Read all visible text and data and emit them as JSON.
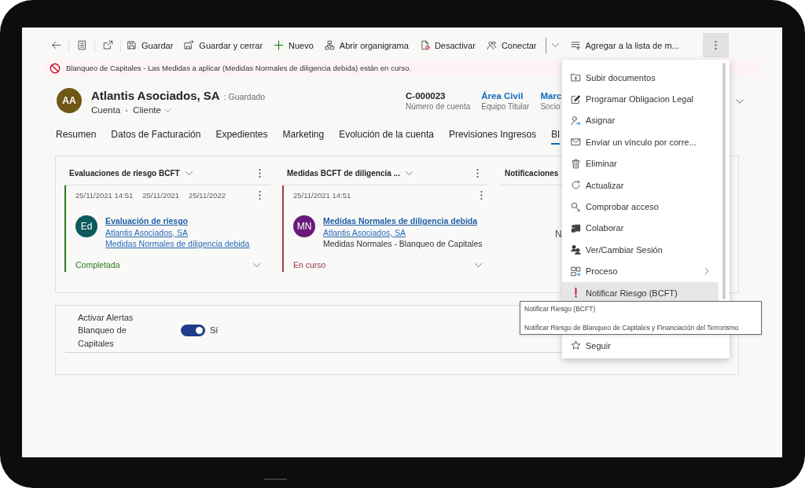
{
  "toolbar": {
    "buttons": [
      {
        "label": "Guardar",
        "kind": "button"
      },
      {
        "label": "Guardar y cerrar",
        "kind": "button"
      },
      {
        "label": "Nuevo",
        "kind": "button"
      },
      {
        "label": "Abrir organigrama",
        "kind": "button"
      },
      {
        "label": "Desactivar",
        "kind": "button"
      },
      {
        "label": "Conectar",
        "kind": "split"
      },
      {
        "label": "Agregar a la lista de m...",
        "kind": "button"
      }
    ],
    "more": {
      "expanded": true
    }
  },
  "notification": {
    "text": "Blanqueo de Capitales - Las Medidas a aplicar (Medidas Normales de diligencia debida) están en curso."
  },
  "header": {
    "avatar": "AA",
    "title": "Atlantis Asociados, SA",
    "save_state": ": Guardado",
    "entity": "Cuenta",
    "form": "Cliente",
    "fields": [
      {
        "value": "C-000023",
        "label": "Número de cuenta",
        "link": false
      },
      {
        "value": "Área Civil",
        "label": "Equipo Titular",
        "link": true
      },
      {
        "value": "Marc",
        "label": "Socio",
        "link": true
      }
    ]
  },
  "tabs": [
    {
      "label": "Resumen",
      "selected": false
    },
    {
      "label": "Datos de Facturación",
      "selected": false
    },
    {
      "label": "Expedientes",
      "selected": false
    },
    {
      "label": "Marketing",
      "selected": false
    },
    {
      "label": "Evolución de la cuenta",
      "selected": false
    },
    {
      "label": "Previsiones Ingresos",
      "selected": false
    },
    {
      "label": "Bl",
      "selected": true
    }
  ],
  "subgrids": [
    {
      "title": "Evaluaciones de riesgo BCFT",
      "controls": true,
      "records": [
        {
          "dates": [
            "25/11/2021 14:51",
            "25/11/2021",
            "25/11/2022"
          ],
          "avatar": {
            "initials": "Ed",
            "color": "#0b5a5c"
          },
          "lines": [
            {
              "text": "Evaluación de riesgo",
              "kind": "title"
            },
            {
              "text": "Atlantis Asociados, SA",
              "kind": "link"
            },
            {
              "text": "Medidas Normales de diligencia debida",
              "kind": "link"
            }
          ],
          "status": "Completada",
          "color": "#2b7a1e"
        }
      ]
    },
    {
      "title": "Medidas BCFT de diligencia ...",
      "controls": true,
      "records": [
        {
          "dates": [
            "25/11/2021 14:51"
          ],
          "avatar": {
            "initials": "MN",
            "color": "#6a1b7a"
          },
          "lines": [
            {
              "text": "Medidas Normales de diligencia debida",
              "kind": "title"
            },
            {
              "text": "Atlantis Asociados, SA",
              "kind": "link"
            },
            {
              "text": "Medidas Normales - Blanqueo de Capitales",
              "kind": "text"
            }
          ],
          "status": "En curso",
          "color": "#a4374f"
        }
      ]
    },
    {
      "title": "Notificaciones",
      "controls": false,
      "empty_text": "N"
    }
  ],
  "alerts": {
    "label": "Activar Alertas Blanqueo de Capitales",
    "on": true,
    "value": "Sí"
  },
  "menu": {
    "items": [
      {
        "label": "Subir documentos",
        "kind": "item",
        "highlighted": false
      },
      {
        "label": "Programar Obligacion Legal",
        "kind": "item",
        "highlighted": false
      },
      {
        "label": "Asignar",
        "kind": "item",
        "highlighted": false
      },
      {
        "label": "Enviar un vínculo por corre...",
        "kind": "item",
        "highlighted": false
      },
      {
        "label": "Eliminar",
        "kind": "item",
        "highlighted": false
      },
      {
        "label": "Actualizar",
        "kind": "item",
        "highlighted": false
      },
      {
        "label": "Comprobar acceso",
        "kind": "item",
        "highlighted": false
      },
      {
        "label": "Colaborar",
        "kind": "item",
        "highlighted": false
      },
      {
        "label": "Ver/Cambiar Sesión",
        "kind": "item",
        "highlighted": false
      },
      {
        "label": "Proceso",
        "kind": "submenu",
        "highlighted": false
      },
      {
        "label": "Notificar Riesgo (BCFT)",
        "kind": "item",
        "highlighted": true
      },
      {
        "label": "Seguir",
        "kind": "item",
        "highlighted": false
      }
    ],
    "tooltip": {
      "title": "Notificar Riesgo (BCFT)",
      "description": "Notificar Riesgo de Blanqueo de Capitales y Financiación del Terrorismo"
    }
  }
}
